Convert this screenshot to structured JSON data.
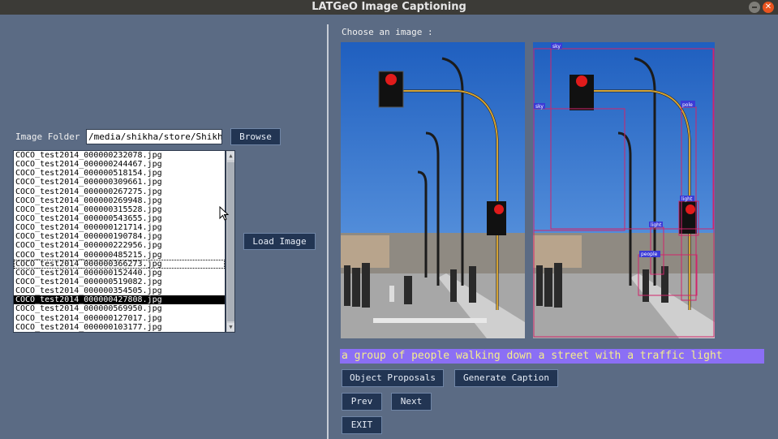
{
  "window": {
    "title": "LATGeO Image Captioning",
    "close_glyph": "✕"
  },
  "left": {
    "folder_label": "Image Folder",
    "folder_value": "/media/shikha/store/Shikh",
    "browse_label": "Browse",
    "load_label": "Load Image",
    "files": [
      "COCO_test2014_000000232078.jpg",
      "COCO_test2014_000000244467.jpg",
      "COCO_test2014_000000518154.jpg",
      "COCO_test2014_000000309661.jpg",
      "COCO_test2014_000000267275.jpg",
      "COCO_test2014_000000269948.jpg",
      "COCO_test2014_000000315528.jpg",
      "COCO_test2014_000000543655.jpg",
      "COCO_test2014_000000121714.jpg",
      "COCO_test2014_000000190784.jpg",
      "COCO_test2014_000000222956.jpg",
      "COCO_test2014_000000485215.jpg",
      "COCO_test2014_000000366273.jpg",
      "COCO_test2014_000000152440.jpg",
      "COCO_test2014_000000519082.jpg",
      "COCO_test2014_000000354505.jpg",
      "COCO_test2014_000000427808.jpg",
      "COCO_test2014_000000569950.jpg",
      "COCO_test2014_000000127017.jpg",
      "COCO_test2014_000000103177.jpg"
    ],
    "selected_file": "COCO_test2014_000000427808.jpg",
    "focused_file": "COCO_test2014_000000366273.jpg"
  },
  "right": {
    "choose_label": "Choose an image :",
    "detections": [
      "sky",
      "sky",
      "pole",
      "light",
      "light",
      "people"
    ],
    "caption": "a group of people walking down a street with a traffic light",
    "proposals_label": "Object Proposals",
    "generate_label": "Generate Caption",
    "prev_label": "Prev",
    "next_label": "Next",
    "exit_label": "EXIT"
  },
  "colors": {
    "background": "#5b6b84",
    "button": "#223553",
    "caption_bg": "#8b6ff5",
    "caption_text": "#f5ef8a",
    "selection": "#000000"
  }
}
